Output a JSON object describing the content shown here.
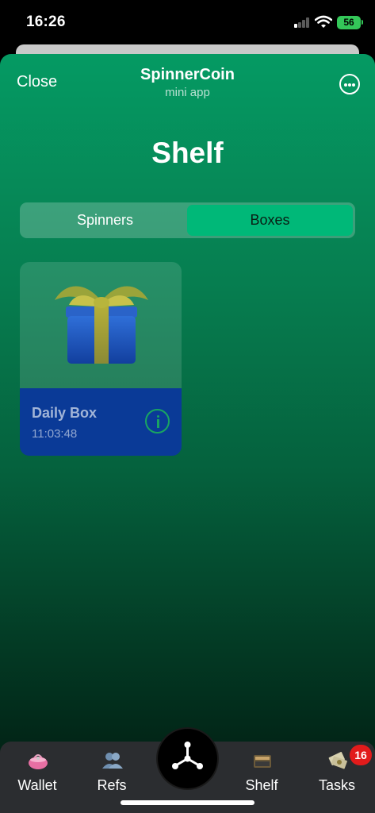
{
  "status_bar": {
    "time": "16:26",
    "battery": "56"
  },
  "header": {
    "close_label": "Close",
    "app_title": "SpinnerCoin",
    "app_subtitle": "mini app",
    "more_icon": "more-horizontal-icon"
  },
  "page": {
    "title": "Shelf"
  },
  "tabs_segmented": {
    "items": [
      {
        "label": "Spinners",
        "selected": false
      },
      {
        "label": "Boxes",
        "selected": true
      }
    ]
  },
  "items": [
    {
      "name": "Daily Box",
      "timer": "11:03:48",
      "icon": "gift-icon",
      "info_icon": "info-icon"
    }
  ],
  "nav": {
    "wallet_label": "Wallet",
    "refs_label": "Refs",
    "shelf_label": "Shelf",
    "tasks_label": "Tasks",
    "tasks_badge": "16",
    "center_icon": "spinner-logo-icon"
  },
  "colors": {
    "accent": "#00b878",
    "card_bottom": "#0a3a97",
    "badge": "#e21b1b",
    "background_top": "#059a63"
  }
}
